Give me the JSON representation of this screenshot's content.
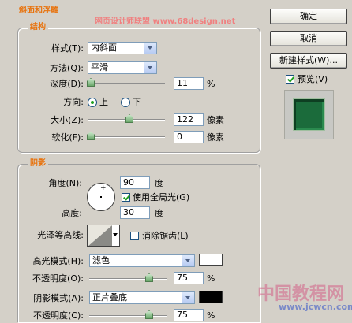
{
  "watermark": {
    "top": "网页设计师联盟  www.68design.net",
    "bottom_cn": "中国教程网",
    "bottom_url": "www.jcwcn.com"
  },
  "panel": {
    "title": "斜面和浮雕",
    "structure": {
      "title": "结构",
      "style_label": "样式(T):",
      "style_value": "内斜面",
      "method_label": "方法(Q):",
      "method_value": "平滑",
      "depth_label": "深度(D):",
      "depth_value": "11",
      "depth_unit": "%",
      "depth_level": 0.011,
      "direction_label": "方向:",
      "dir_up": "上",
      "dir_down": "下",
      "dir_selected": "上",
      "size_label": "大小(Z):",
      "size_value": "122",
      "size_unit": "像素",
      "size_level": 0.49,
      "soften_label": "软化(F):",
      "soften_value": "0",
      "soften_unit": "像素",
      "soften_level": 0.0
    },
    "shading": {
      "title": "阴影",
      "angle_label": "角度(N):",
      "angle_value": "90",
      "angle_unit": "度",
      "global_light_label": "使用全局光(G)",
      "global_light_checked": true,
      "altitude_label": "高度:",
      "altitude_value": "30",
      "altitude_unit": "度",
      "gloss_label": "光泽等高线:",
      "antialias_label": "消除锯齿(L)",
      "antialias_checked": false,
      "highlight_mode_label": "高光模式(H):",
      "highlight_mode_value": "滤色",
      "highlight_color": "#ffffff",
      "highlight_opacity_label": "不透明度(O):",
      "highlight_opacity_value": "75",
      "highlight_opacity_unit": "%",
      "highlight_opacity_level": 0.75,
      "shadow_mode_label": "阴影模式(A):",
      "shadow_mode_value": "正片叠底",
      "shadow_color": "#000000",
      "shadow_opacity_label": "不透明度(C):",
      "shadow_opacity_value": "75",
      "shadow_opacity_unit": "%",
      "shadow_opacity_level": 0.75
    }
  },
  "buttons": {
    "ok": "确定",
    "cancel": "取消",
    "new_style": "新建样式(W)..."
  },
  "preview": {
    "label": "预览(V)",
    "checked": true
  },
  "colors": {
    "accent_title": "#e8720c",
    "preview_fill": "#1b6b3b"
  }
}
